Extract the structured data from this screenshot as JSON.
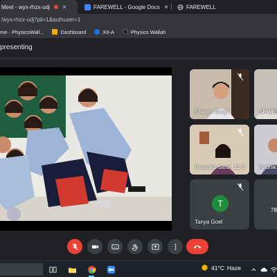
{
  "browser": {
    "tabs": [
      {
        "title": "Meet - wyx-rhzx-udj",
        "active": true,
        "recording": true
      },
      {
        "title": "FAREWELL - Google Docs",
        "active": false
      },
      {
        "title": "FAREWELL",
        "active": false
      }
    ],
    "url": "/wyx-rhzx-udj?pli=1&authuser=1",
    "bookmarks": [
      {
        "label": "me - PhysicsWall...",
        "icon": "physicswallah-icon"
      },
      {
        "label": "Dashboard",
        "icon": "folder-icon"
      },
      {
        "label": "XII-A",
        "icon": "edge-icon"
      },
      {
        "label": "Physics Wallah",
        "icon": "physicswallah-icon"
      }
    ]
  },
  "meet": {
    "presenting_label": "presenting",
    "participants": [
      {
        "name": "Shivam Singh",
        "muted": true
      },
      {
        "name": "SHWET",
        "muted": false
      },
      {
        "name": "Priyanka Saraf ,11 C",
        "muted": true
      },
      {
        "name": "Radhik",
        "muted": false
      },
      {
        "name": "Tanya Goel",
        "muted": true,
        "avatar_letter": "T",
        "avatar_color": "#1e8e3e"
      },
      {
        "name": "",
        "muted": false,
        "overflow_count": "78"
      }
    ],
    "controls": [
      {
        "name": "mic-off",
        "state": "off"
      },
      {
        "name": "camera",
        "state": "on"
      },
      {
        "name": "captions",
        "state": "on"
      },
      {
        "name": "raise-hand",
        "state": "on"
      },
      {
        "name": "present",
        "state": "on"
      },
      {
        "name": "more-options",
        "state": "on"
      },
      {
        "name": "leave-call",
        "state": "danger"
      }
    ]
  },
  "taskbar": {
    "temperature": "41°C",
    "weather_text": "Haze",
    "apps": [
      "task-view-icon",
      "file-explorer-icon",
      "chrome-icon",
      "zoom-icon"
    ]
  },
  "colors": {
    "bg": "#202124",
    "accent_red": "#ea4335",
    "avatar_green": "#1e8e3e"
  }
}
